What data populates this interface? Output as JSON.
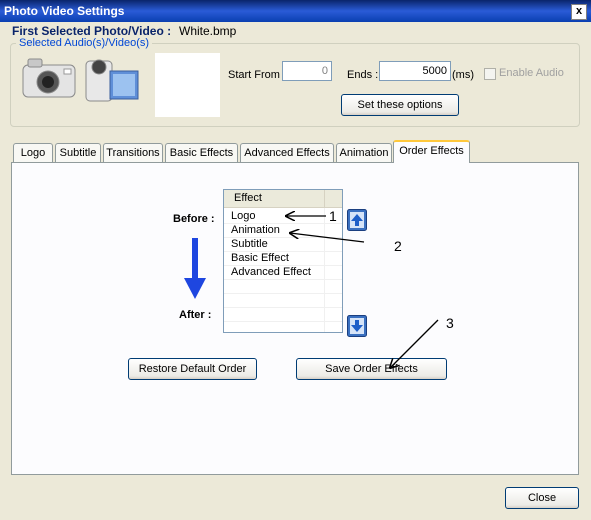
{
  "window": {
    "title": "Photo Video Settings",
    "close_glyph": "x"
  },
  "first_selected": {
    "label": "First Selected Photo/Video :",
    "value": "White.bmp"
  },
  "media_group": {
    "caption": "Selected Audio(s)/Video(s)",
    "start_from_label": "Start From :",
    "start_from_value": "0",
    "ends_label": "Ends :",
    "ends_value": "5000",
    "ends_unit": "(ms)",
    "enable_audio_label": "Enable Audio",
    "enable_audio_checked": false,
    "set_options_label": "Set these options",
    "icons": [
      "camera-icon",
      "video-camera-icon"
    ]
  },
  "tabs": [
    {
      "label": "Logo",
      "active": false
    },
    {
      "label": "Subtitle",
      "active": false
    },
    {
      "label": "Transitions",
      "active": false
    },
    {
      "label": "Basic Effects",
      "active": false
    },
    {
      "label": "Advanced Effects",
      "active": false
    },
    {
      "label": "Animation",
      "active": false
    },
    {
      "label": "Order Effects",
      "active": true
    }
  ],
  "order_effects": {
    "before_label": "Before :",
    "after_label": "After :",
    "column_header": "Effect",
    "items": [
      "Logo",
      "Animation",
      "Subtitle",
      "Basic Effect",
      "Advanced Effect"
    ],
    "restore_label": "Restore Default Order",
    "save_label": "Save Order Effects",
    "annotations": [
      "1",
      "2",
      "3"
    ]
  },
  "footer": {
    "close_label": "Close"
  },
  "colors": {
    "title_bar": "#0A246A",
    "accent_blue": "#1E46E0",
    "tab_highlight": "#FFC83C"
  }
}
